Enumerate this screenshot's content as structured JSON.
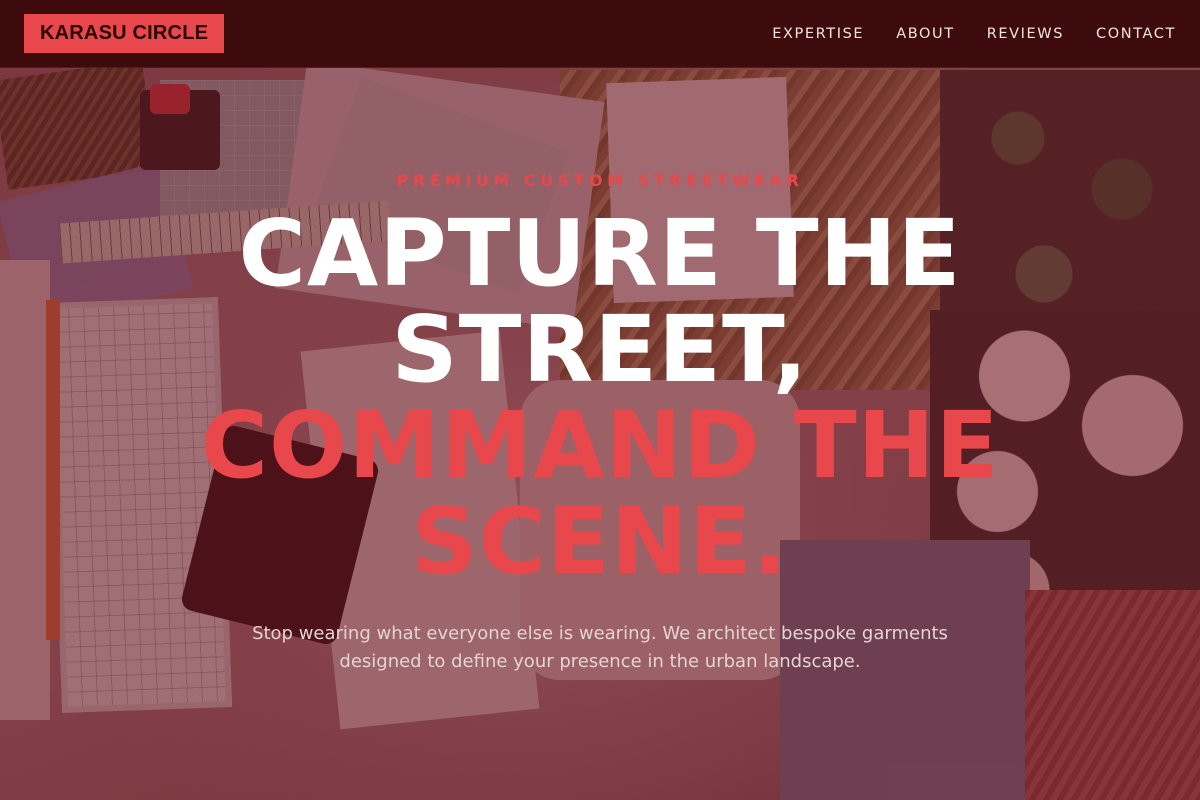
{
  "header": {
    "logo": "KARASU CIRCLE",
    "nav": [
      {
        "label": "EXPERTISE"
      },
      {
        "label": "ABOUT"
      },
      {
        "label": "REVIEWS"
      },
      {
        "label": "CONTACT"
      }
    ]
  },
  "hero": {
    "eyebrow": "PREMIUM CUSTOM STREETWEAR",
    "headline_lines": [
      {
        "text": "CAPTURE THE"
      },
      {
        "text": "STREET,"
      },
      {
        "text": "COMMAND THE"
      },
      {
        "text": "SCENE."
      }
    ],
    "subtext": "Stop wearing what everyone else is wearing. We architect bespoke garments designed to define your presence in the urban landscape."
  },
  "colors": {
    "accent": "#e8474c",
    "header_bg": "#3e0b0d",
    "overlay": "#6e1620"
  }
}
